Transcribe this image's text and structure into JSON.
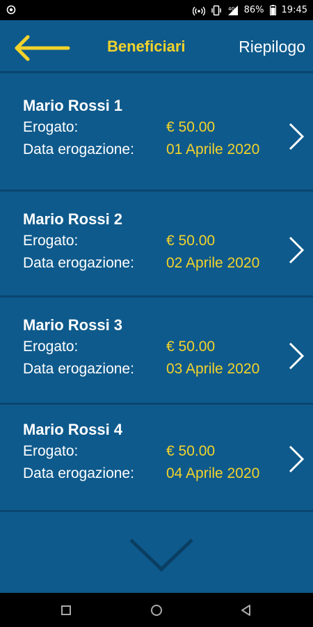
{
  "status_bar": {
    "battery": "86%",
    "time": "19:45",
    "icons": [
      "app-notification-icon",
      "hotspot-icon",
      "vibrate-icon",
      "signal-icon",
      "battery-icon"
    ]
  },
  "header": {
    "back_icon": "arrow-left-icon",
    "title": "Beneficiari",
    "summary_label": "Riepilogo"
  },
  "beneficiaries": [
    {
      "name": "Mario Rossi 1",
      "amount_label": "Erogato:",
      "amount": "€ 50.00",
      "date_label": "Data erogazione:",
      "date": "01 Aprile 2020"
    },
    {
      "name": "Mario Rossi 2",
      "amount_label": "Erogato:",
      "amount": "€ 50.00",
      "date_label": "Data erogazione:",
      "date": "02 Aprile 2020"
    },
    {
      "name": "Mario Rossi 3",
      "amount_label": "Erogato:",
      "amount": "€ 50.00",
      "date_label": "Data erogazione:",
      "date": "03 Aprile 2020"
    },
    {
      "name": "Mario Rossi 4",
      "amount_label": "Erogato:",
      "amount": "€ 50.00",
      "date_label": "Data erogazione:",
      "date": "04 Aprile 2020"
    }
  ],
  "more_icon": "chevron-down-icon",
  "nav_bar": {
    "icons": [
      "recent-apps-icon",
      "home-icon",
      "back-icon"
    ]
  },
  "colors": {
    "background": "#0e5a8c",
    "accent": "#f3d32b",
    "divider": "#0a4670",
    "text": "#ffffff"
  }
}
